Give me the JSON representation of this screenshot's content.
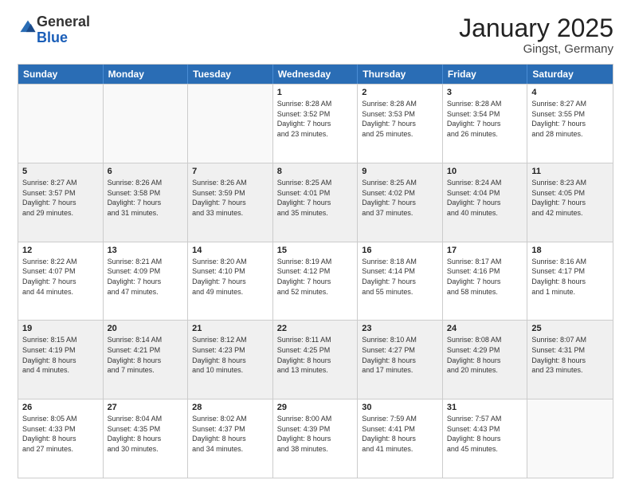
{
  "logo": {
    "general": "General",
    "blue": "Blue"
  },
  "title": "January 2025",
  "subtitle": "Gingst, Germany",
  "days": [
    "Sunday",
    "Monday",
    "Tuesday",
    "Wednesday",
    "Thursday",
    "Friday",
    "Saturday"
  ],
  "rows": [
    [
      {
        "day": "",
        "text": "",
        "empty": true
      },
      {
        "day": "",
        "text": "",
        "empty": true
      },
      {
        "day": "",
        "text": "",
        "empty": true
      },
      {
        "day": "1",
        "text": "Sunrise: 8:28 AM\nSunset: 3:52 PM\nDaylight: 7 hours\nand 23 minutes."
      },
      {
        "day": "2",
        "text": "Sunrise: 8:28 AM\nSunset: 3:53 PM\nDaylight: 7 hours\nand 25 minutes."
      },
      {
        "day": "3",
        "text": "Sunrise: 8:28 AM\nSunset: 3:54 PM\nDaylight: 7 hours\nand 26 minutes."
      },
      {
        "day": "4",
        "text": "Sunrise: 8:27 AM\nSunset: 3:55 PM\nDaylight: 7 hours\nand 28 minutes."
      }
    ],
    [
      {
        "day": "5",
        "text": "Sunrise: 8:27 AM\nSunset: 3:57 PM\nDaylight: 7 hours\nand 29 minutes.",
        "shaded": true
      },
      {
        "day": "6",
        "text": "Sunrise: 8:26 AM\nSunset: 3:58 PM\nDaylight: 7 hours\nand 31 minutes.",
        "shaded": true
      },
      {
        "day": "7",
        "text": "Sunrise: 8:26 AM\nSunset: 3:59 PM\nDaylight: 7 hours\nand 33 minutes.",
        "shaded": true
      },
      {
        "day": "8",
        "text": "Sunrise: 8:25 AM\nSunset: 4:01 PM\nDaylight: 7 hours\nand 35 minutes.",
        "shaded": true
      },
      {
        "day": "9",
        "text": "Sunrise: 8:25 AM\nSunset: 4:02 PM\nDaylight: 7 hours\nand 37 minutes.",
        "shaded": true
      },
      {
        "day": "10",
        "text": "Sunrise: 8:24 AM\nSunset: 4:04 PM\nDaylight: 7 hours\nand 40 minutes.",
        "shaded": true
      },
      {
        "day": "11",
        "text": "Sunrise: 8:23 AM\nSunset: 4:05 PM\nDaylight: 7 hours\nand 42 minutes.",
        "shaded": true
      }
    ],
    [
      {
        "day": "12",
        "text": "Sunrise: 8:22 AM\nSunset: 4:07 PM\nDaylight: 7 hours\nand 44 minutes."
      },
      {
        "day": "13",
        "text": "Sunrise: 8:21 AM\nSunset: 4:09 PM\nDaylight: 7 hours\nand 47 minutes."
      },
      {
        "day": "14",
        "text": "Sunrise: 8:20 AM\nSunset: 4:10 PM\nDaylight: 7 hours\nand 49 minutes."
      },
      {
        "day": "15",
        "text": "Sunrise: 8:19 AM\nSunset: 4:12 PM\nDaylight: 7 hours\nand 52 minutes."
      },
      {
        "day": "16",
        "text": "Sunrise: 8:18 AM\nSunset: 4:14 PM\nDaylight: 7 hours\nand 55 minutes."
      },
      {
        "day": "17",
        "text": "Sunrise: 8:17 AM\nSunset: 4:16 PM\nDaylight: 7 hours\nand 58 minutes."
      },
      {
        "day": "18",
        "text": "Sunrise: 8:16 AM\nSunset: 4:17 PM\nDaylight: 8 hours\nand 1 minute."
      }
    ],
    [
      {
        "day": "19",
        "text": "Sunrise: 8:15 AM\nSunset: 4:19 PM\nDaylight: 8 hours\nand 4 minutes.",
        "shaded": true
      },
      {
        "day": "20",
        "text": "Sunrise: 8:14 AM\nSunset: 4:21 PM\nDaylight: 8 hours\nand 7 minutes.",
        "shaded": true
      },
      {
        "day": "21",
        "text": "Sunrise: 8:12 AM\nSunset: 4:23 PM\nDaylight: 8 hours\nand 10 minutes.",
        "shaded": true
      },
      {
        "day": "22",
        "text": "Sunrise: 8:11 AM\nSunset: 4:25 PM\nDaylight: 8 hours\nand 13 minutes.",
        "shaded": true
      },
      {
        "day": "23",
        "text": "Sunrise: 8:10 AM\nSunset: 4:27 PM\nDaylight: 8 hours\nand 17 minutes.",
        "shaded": true
      },
      {
        "day": "24",
        "text": "Sunrise: 8:08 AM\nSunset: 4:29 PM\nDaylight: 8 hours\nand 20 minutes.",
        "shaded": true
      },
      {
        "day": "25",
        "text": "Sunrise: 8:07 AM\nSunset: 4:31 PM\nDaylight: 8 hours\nand 23 minutes.",
        "shaded": true
      }
    ],
    [
      {
        "day": "26",
        "text": "Sunrise: 8:05 AM\nSunset: 4:33 PM\nDaylight: 8 hours\nand 27 minutes."
      },
      {
        "day": "27",
        "text": "Sunrise: 8:04 AM\nSunset: 4:35 PM\nDaylight: 8 hours\nand 30 minutes."
      },
      {
        "day": "28",
        "text": "Sunrise: 8:02 AM\nSunset: 4:37 PM\nDaylight: 8 hours\nand 34 minutes."
      },
      {
        "day": "29",
        "text": "Sunrise: 8:00 AM\nSunset: 4:39 PM\nDaylight: 8 hours\nand 38 minutes."
      },
      {
        "day": "30",
        "text": "Sunrise: 7:59 AM\nSunset: 4:41 PM\nDaylight: 8 hours\nand 41 minutes."
      },
      {
        "day": "31",
        "text": "Sunrise: 7:57 AM\nSunset: 4:43 PM\nDaylight: 8 hours\nand 45 minutes."
      },
      {
        "day": "",
        "text": "",
        "empty": true
      }
    ]
  ]
}
